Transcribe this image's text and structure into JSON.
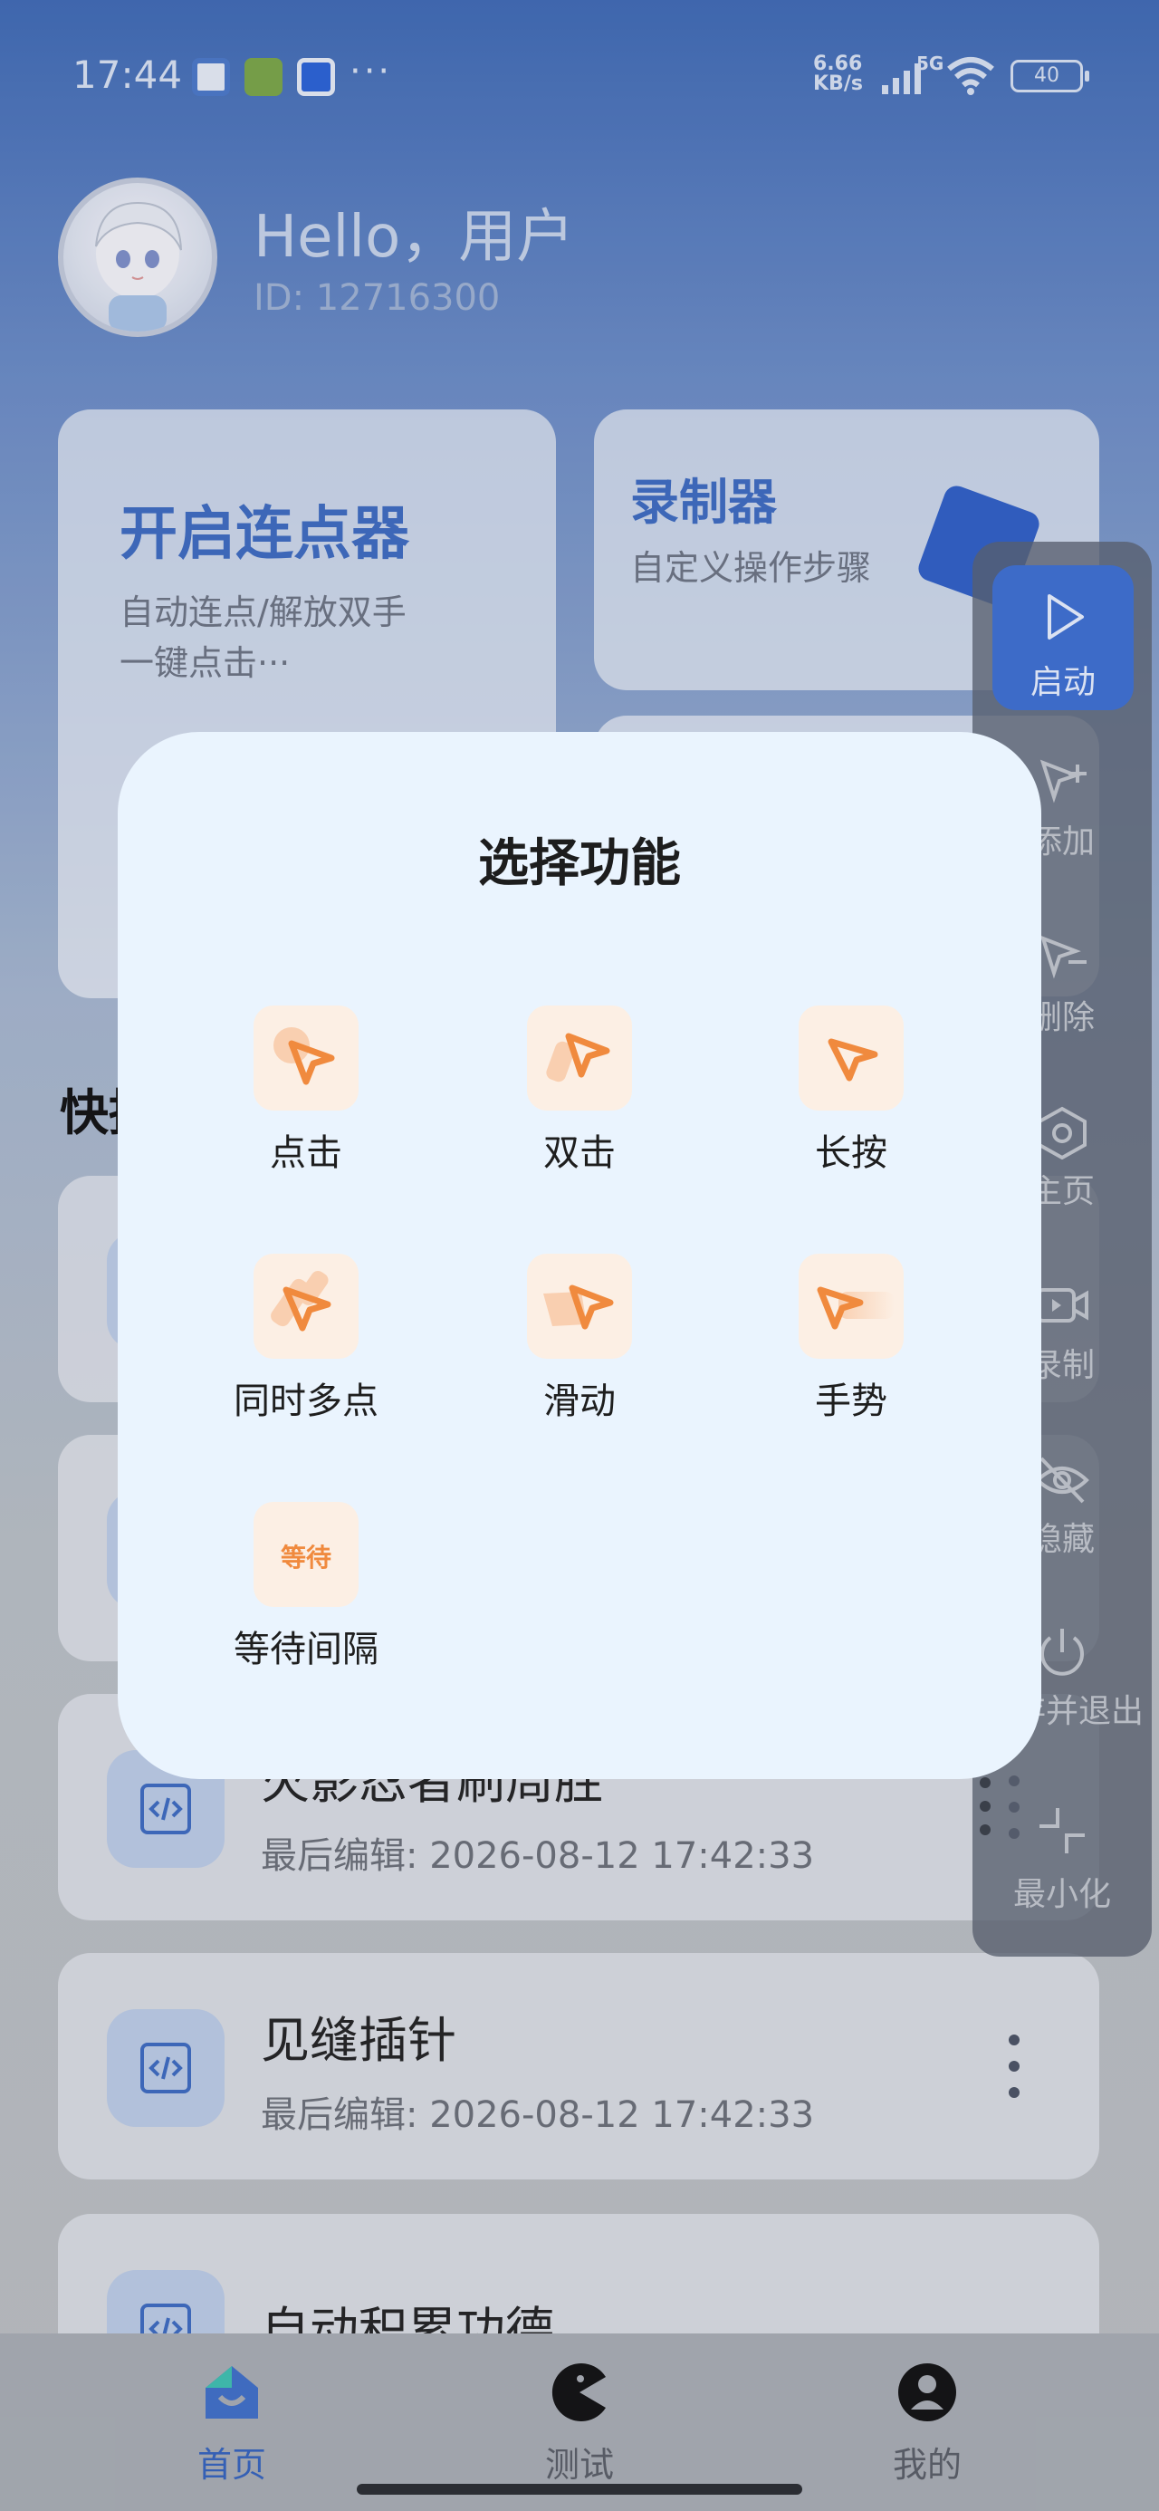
{
  "status_bar": {
    "time": "17:44",
    "dots": "···",
    "net_speed_value": "6.66",
    "net_speed_unit": "KB/s",
    "network": "5G",
    "battery": "40",
    "notification_icons": [
      "qq-browser-icon",
      "game-icon",
      "qq-icon"
    ]
  },
  "user": {
    "greeting": "Hello，用户",
    "id": "ID: 12716300"
  },
  "cards": {
    "clicker_title": "开启连点器",
    "clicker_sub_1": "自动连点/解放双手",
    "clicker_sub_2": "一键点击···",
    "recorder_title": "录制器",
    "recorder_sub": "自定义操作步骤"
  },
  "quick": {
    "title": "快捷"
  },
  "list": [
    {
      "name": "火影忍者刷周胜",
      "edited": "最后编辑: 2026-08-12 17:42:33"
    },
    {
      "name": "见缝插针",
      "edited": "最后编辑: 2026-08-12 17:42:33"
    },
    {
      "name": "自动积累功德",
      "edited": ""
    }
  ],
  "float_panel": {
    "start": "启动",
    "add": "添加",
    "delete": "删除",
    "home": "主页",
    "record": "录制",
    "hide": "隐藏",
    "save_exit": "保存并退出",
    "minimize": "最小化"
  },
  "dialog": {
    "title": "选择功能",
    "functions": [
      {
        "label": "点击",
        "icon": "tap-icon"
      },
      {
        "label": "双击",
        "icon": "double-tap-icon"
      },
      {
        "label": "长按",
        "icon": "long-press-icon"
      },
      {
        "label": "同时多点",
        "icon": "multi-point-icon"
      },
      {
        "label": "滑动",
        "icon": "swipe-icon"
      },
      {
        "label": "手势",
        "icon": "gesture-icon"
      },
      {
        "label": "等待间隔",
        "icon": "wait-icon",
        "tile_text": "等待"
      }
    ]
  },
  "bottom_nav": {
    "home": "首页",
    "test": "测试",
    "mine": "我的"
  },
  "colors": {
    "accent": "#3d6bc0",
    "orange": "#f08a3e",
    "dialog_bg": "#eaf4fe"
  }
}
